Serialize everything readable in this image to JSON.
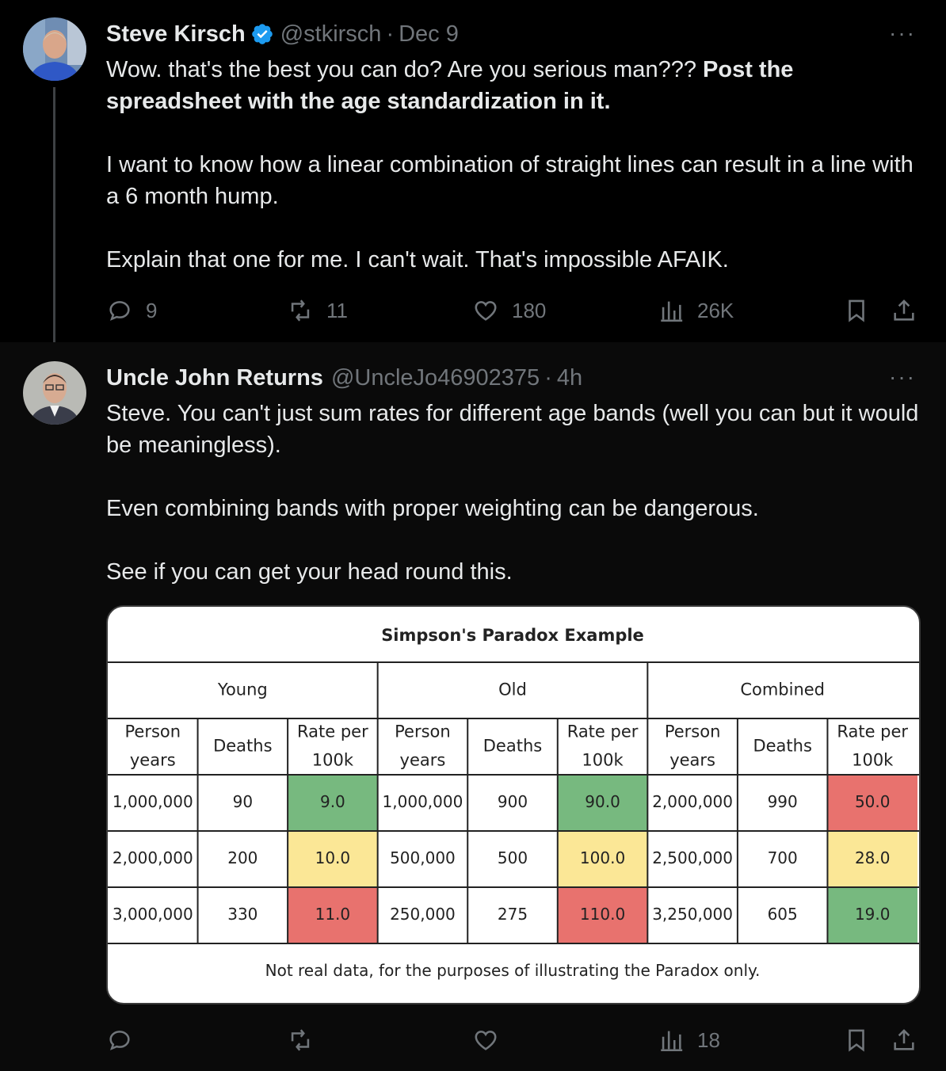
{
  "tweet1": {
    "author_name": "Steve Kirsch",
    "handle": "@stkirsch",
    "separator": "·",
    "time": "Dec 9",
    "more": "···",
    "text_p1_plain": "Wow. that's the best you can do? Are you serious man??? ",
    "text_p1_bold": "Post the spreadsheet with the age standardization in it.",
    "text_p2": "I want to know how a linear combination of straight lines can result in a line with a 6 month hump.",
    "text_p3": "Explain that one for me. I can't wait. That's impossible AFAIK.",
    "replies": "9",
    "retweets": "11",
    "likes": "180",
    "views": "26K"
  },
  "tweet2": {
    "author_name": "Uncle John Returns",
    "handle": "@UncleJo46902375",
    "separator": "·",
    "time": "4h",
    "more": "···",
    "text_p1": "Steve. You can't just sum rates for different age bands (well you can but it would be meaningless).",
    "text_p2": "Even combining bands with proper weighting can be dangerous.",
    "text_p3": "See if you can get your head round this.",
    "views": "18"
  },
  "table": {
    "title": "Simpson's Paradox Example",
    "groups": [
      "Young",
      "Old",
      "Combined"
    ],
    "columns": [
      "Person years",
      "Deaths",
      "Rate per 100k"
    ],
    "column_lines": [
      [
        "Person",
        "years"
      ],
      [
        "Deaths"
      ],
      [
        "Rate per",
        "100k"
      ]
    ],
    "rows": [
      [
        "1,000,000",
        "90",
        "9.0",
        "1,000,000",
        "900",
        "90.0",
        "2,000,000",
        "990",
        "50.0"
      ],
      [
        "2,000,000",
        "200",
        "10.0",
        "500,000",
        "500",
        "100.0",
        "2,500,000",
        "700",
        "28.0"
      ],
      [
        "3,000,000",
        "330",
        "11.0",
        "250,000",
        "275",
        "110.0",
        "3,250,000",
        "605",
        "19.0"
      ]
    ],
    "rate_colors": [
      [
        "#77b97f",
        "#77b97f",
        "#e8726e"
      ],
      [
        "#fbe796",
        "#fbe796",
        "#fbe796"
      ],
      [
        "#e8726e",
        "#e8726e",
        "#77b97f"
      ]
    ],
    "footnote": "Not real data, for the purposes of illustrating the Paradox only."
  },
  "colors": {
    "background": "#000000",
    "text": "#e7e9ea",
    "muted": "#71767b",
    "verified": "#1d9bf0"
  }
}
